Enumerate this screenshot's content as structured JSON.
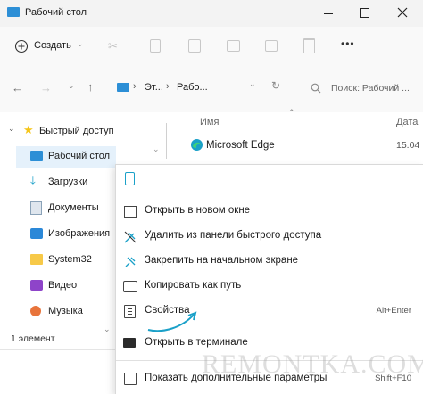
{
  "window": {
    "title": "Рабочий стол"
  },
  "toolbar": {
    "create_label": "Создать",
    "more_label": "•••"
  },
  "address": {
    "crumb1": "Эт...",
    "crumb2": "Рабо...",
    "search_placeholder": "Поиск: Рабочий ..."
  },
  "columns": {
    "name": "Имя",
    "date": "Дата"
  },
  "files": [
    {
      "name": "Microsoft Edge",
      "date": "15.04"
    }
  ],
  "nav": {
    "quick_access": "Быстрый доступ",
    "items": [
      {
        "label": "Рабочий стол"
      },
      {
        "label": "Загрузки"
      },
      {
        "label": "Документы"
      },
      {
        "label": "Изображения"
      },
      {
        "label": "System32"
      },
      {
        "label": "Видео"
      },
      {
        "label": "Музыка"
      }
    ]
  },
  "status": {
    "count": "1 элемент"
  },
  "context_menu": {
    "items": [
      {
        "label": "Открыть в новом окне",
        "shortcut": ""
      },
      {
        "label": "Удалить из панели быстрого доступа",
        "shortcut": ""
      },
      {
        "label": "Закрепить на начальном экране",
        "shortcut": ""
      },
      {
        "label": "Копировать как путь",
        "shortcut": ""
      },
      {
        "label": "Свойства",
        "shortcut": "Alt+Enter"
      },
      {
        "label": "Открыть в терминале",
        "shortcut": ""
      },
      {
        "label": "Показать дополнительные параметры",
        "shortcut": "Shift+F10"
      }
    ]
  },
  "watermark": "REMONTKA.COM",
  "colors": {
    "accent": "#0067c0",
    "folder": "#f7c948",
    "star": "#f5c518",
    "arrow": "#1aa0c8"
  }
}
